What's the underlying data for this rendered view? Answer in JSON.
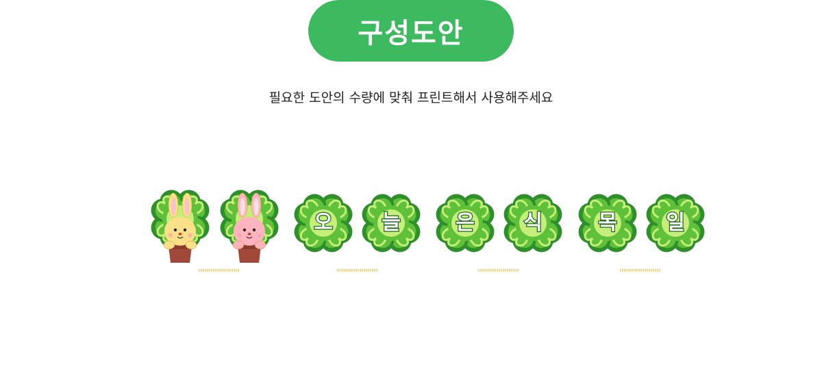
{
  "header": {
    "title": "구성도안",
    "subtitle": "필요한 도안의 수량에 맞춰 프린트해서 사용해주세요"
  },
  "banner": {
    "characters": [
      "오",
      "늘",
      "은",
      "식",
      "목",
      "일"
    ],
    "mascots": [
      "yellow-bunny",
      "pink-bunny"
    ]
  },
  "colors": {
    "accent": "#3dba5f",
    "clover_dark": "#2f8f2a",
    "clover_mid": "#5fc03a",
    "clover_light": "#c6ee7a",
    "pot": "#a0493a",
    "fine_print": "#f0c040"
  }
}
